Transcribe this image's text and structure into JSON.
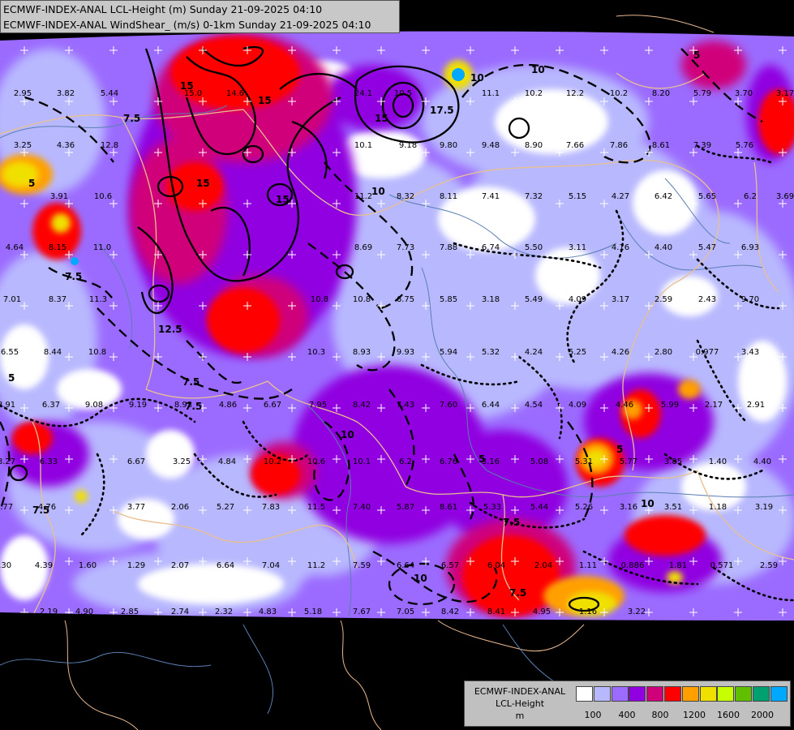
{
  "header": {
    "line1": "ECMWF-INDEX-ANAL LCL-Height (m) Sunday 21-09-2025 04:10",
    "line2": "ECMWF-INDEX-ANAL WindShear_ (m/s) 0-1km Sunday 21-09-2025 04:10"
  },
  "legend": {
    "line1": "ECMWF-INDEX-ANAL",
    "line2": "LCL-Height",
    "line3": "m",
    "colors": [
      "#ffffff",
      "#b8b8ff",
      "#9b6bff",
      "#9000e0",
      "#d0007a",
      "#ff0000",
      "#ffa000",
      "#f0e000",
      "#c8ff00",
      "#60c000",
      "#00a070",
      "#00a8ff"
    ],
    "ticks": [
      "100",
      "400",
      "800",
      "1200",
      "1600",
      "2000"
    ]
  },
  "map_values": [
    "2.95",
    "3.82",
    "5.44",
    "15.0",
    "14.6",
    "24.1",
    "10.5",
    "11.1",
    "10.2",
    "12.2",
    "10.2",
    "8.20",
    "5.79",
    "3.70",
    "3.17",
    "3.25",
    "4.36",
    "12.8",
    "10.1",
    "9.18",
    "9.80",
    "9.48",
    "8.90",
    "7.66",
    "7.86",
    "8.61",
    "7.39",
    "5.76",
    "3.91",
    "10.6",
    "11.2",
    "8.32",
    "8.11",
    "7.41",
    "7.32",
    "5.15",
    "4.27",
    "6.42",
    "5.65",
    "6.2",
    "3.69",
    "4.64",
    "8.15",
    "11.0",
    "8.69",
    "7.73",
    "7.88",
    "6.74",
    "5.50",
    "3.11",
    "4.16",
    "4.40",
    "5.47",
    "6.93",
    "7.01",
    "8.37",
    "11.3",
    "10.8",
    "10.8",
    "6.75",
    "5.85",
    "3.18",
    "5.49",
    "4.09",
    "3.17",
    "2.59",
    "2.43",
    "9.70",
    "6.55",
    "8.44",
    "10.8",
    "10.3",
    "8.93",
    "9.93",
    "5.94",
    "5.32",
    "4.24",
    "5.25",
    "4.26",
    "2.80",
    "0.977",
    "3.43",
    "8.91",
    "6.37",
    "9.08",
    "9.19",
    "8.93",
    "4.86",
    "6.67",
    "7.95",
    "8.42",
    "7.43",
    "7.60",
    "6.44",
    "4.54",
    "4.09",
    "4.46",
    "5.99",
    "2.17",
    "2.91",
    "8.27",
    "6.33",
    "6.67",
    "3.25",
    "4.84",
    "10.2",
    "10.6",
    "10.1",
    "6.2",
    "6.76",
    "3.16",
    "5.08",
    "5.31",
    "5.77",
    "3.85",
    "1.40",
    "4.40",
    "5.77",
    "4.76",
    "3.77",
    "2.06",
    "5.27",
    "7.83",
    "11.5",
    "7.40",
    "5.87",
    "8.61",
    "5.33",
    "5.44",
    "5.26",
    "3.16",
    "3.51",
    "1.18",
    "3.19",
    "4.30",
    "4.39",
    "1.60",
    "1.29",
    "2.07",
    "6.64",
    "7.04",
    "11.2",
    "7.59",
    "6.64",
    "6.57",
    "6.04",
    "2.04",
    "1.11",
    "0.886",
    "1.81",
    "0.571",
    "2.59",
    "2.19",
    "4.90",
    "2.85",
    "2.74",
    "2.32",
    "4.83",
    "5.18",
    "7.67",
    "7.05",
    "8.42",
    "8.41",
    "4.95",
    "1.16",
    "3.22"
  ],
  "contour_labels": [
    "15",
    "15",
    "15",
    "15",
    "17.5",
    "10",
    "7.5",
    "5",
    "7.5",
    "12.5",
    "10",
    "7.5",
    "5",
    "7.5",
    "10",
    "5",
    "15",
    "10",
    "7.5",
    "5",
    "10",
    "5",
    "7.5",
    "10",
    "7.5"
  ]
}
